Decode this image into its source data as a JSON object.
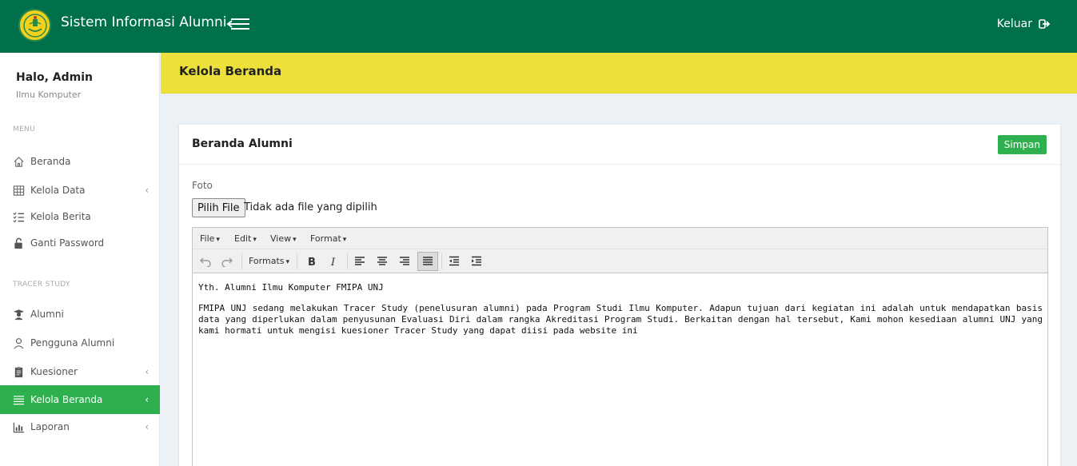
{
  "app": {
    "title": "Sistem Informasi Alumni",
    "logout_label": "Keluar"
  },
  "sidebar": {
    "user_name": "Halo, Admin",
    "user_dept": "Ilmu Komputer",
    "menu_heading": "MENU",
    "tracer_heading": "TRACER STUDY",
    "items": [
      {
        "label": "Beranda",
        "icon": "home-icon"
      },
      {
        "label": "Kelola Data",
        "icon": "table-icon",
        "chevron": "‹"
      },
      {
        "label": "Kelola Berita",
        "icon": "checklist-icon"
      },
      {
        "label": "Ganti Password",
        "icon": "unlock-icon"
      },
      {
        "label": "Alumni",
        "icon": "graduate-icon"
      },
      {
        "label": "Pengguna Alumni",
        "icon": "user-icon"
      },
      {
        "label": "Kuesioner",
        "icon": "clipboard-icon",
        "chevron": "‹"
      },
      {
        "label": "Kelola Beranda",
        "icon": "lines-icon",
        "chevron": "‹",
        "active": true
      },
      {
        "label": "Laporan",
        "icon": "bar-chart-icon",
        "chevron": "‹"
      }
    ]
  },
  "header": {
    "title": "Kelola Beranda"
  },
  "card": {
    "title": "Beranda Alumni",
    "save_label": "Simpan",
    "foto_label": "Foto",
    "file_button": "Pilih File",
    "file_status": "Tidak ada file yang dipilih"
  },
  "editor": {
    "menus": [
      "File",
      "Edit",
      "View",
      "Format"
    ],
    "formats_label": "Formats",
    "paragraphs": [
      "Yth. Alumni Ilmu Komputer FMIPA UNJ",
      "FMIPA UNJ sedang melakukan Tracer Study (penelusuran alumni) pada Program Studi Ilmu Komputer. Adapun tujuan dari kegiatan ini adalah untuk mendapatkan basis data yang diperlukan dalam penyusunan Evaluasi Diri dalam rangka Akreditasi Program Studi. Berkaitan dengan hal tersebut, Kami mohon kesediaan alumni UNJ yang kami hormati untuk mengisi kuesioner Tracer Study yang dapat diisi pada website ini"
    ]
  },
  "colors": {
    "topbar": "#00704a",
    "header_band": "#eee03a",
    "accent_green": "#2fb04f"
  }
}
